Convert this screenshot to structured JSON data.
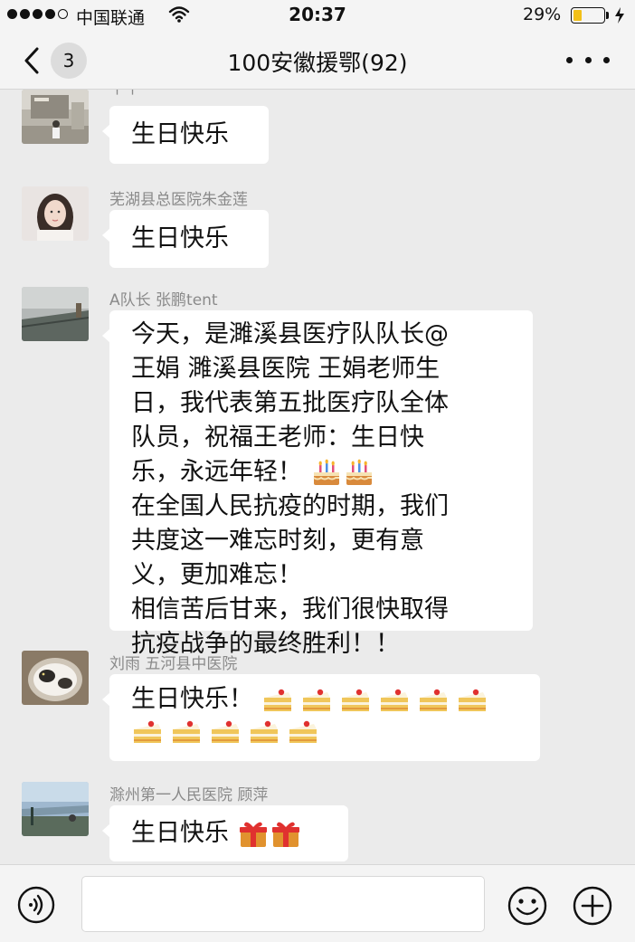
{
  "status_bar": {
    "carrier": "中国联通",
    "time": "20:37",
    "battery_percent_text": "29%",
    "battery_level": 0.29
  },
  "nav": {
    "unread_count": "3",
    "title": "100安徽援鄂(92)"
  },
  "messages": [
    {
      "sender": "午午",
      "text": "生日快乐",
      "emojis": []
    },
    {
      "sender": "芜湖县总医院朱金莲",
      "text": "生日快乐",
      "emojis": []
    },
    {
      "sender": "A队长 张鹏tent",
      "line1": "今天，是濉溪县医疗队队长@",
      "line2": "王娟 濉溪县医院 王娟老师生",
      "line3": "日，我代表第五批医疗队全体",
      "line4": "队员，祝福王老师：生日快",
      "line5": "乐，永远年轻！",
      "line6": "在全国人民抗疫的时期，我们",
      "line7": "共度这一难忘时刻，更有意",
      "line8": "义，更加难忘！",
      "line9": "相信苦后甘来，我们很快取得",
      "line10": "抗疫战争的最终胜利！！",
      "emojis": [
        "birthday-cake",
        "birthday-cake"
      ]
    },
    {
      "sender": "刘雨  五河县中医院",
      "text": "生日快乐！",
      "emojis": [
        "shortcake",
        "shortcake",
        "shortcake",
        "shortcake",
        "shortcake",
        "shortcake",
        "shortcake",
        "shortcake",
        "shortcake",
        "shortcake",
        "shortcake"
      ]
    },
    {
      "sender": "滁州第一人民医院 顾萍",
      "text": "生日快乐",
      "emojis": [
        "gift",
        "gift"
      ]
    }
  ],
  "input_bar": {
    "placeholder": "",
    "icons": [
      "voice-icon",
      "emoji-face-icon",
      "plus-icon"
    ]
  },
  "colors": {
    "background": "#ebebeb",
    "bubble": "#ffffff",
    "battery_fill": "#f2c018"
  }
}
